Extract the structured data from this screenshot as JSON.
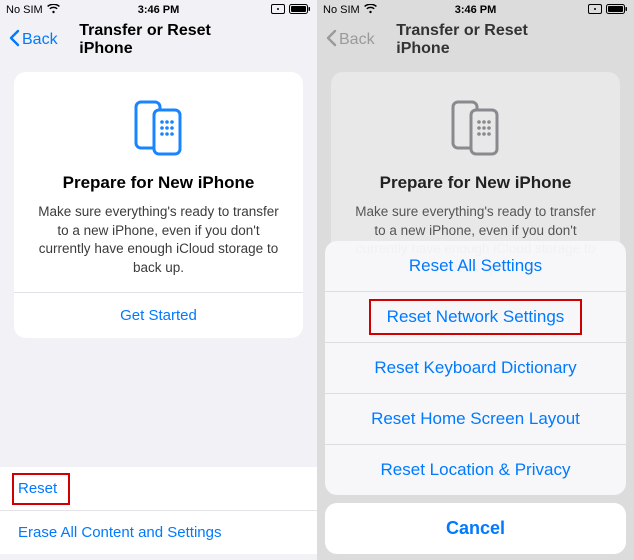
{
  "status": {
    "carrier": "No SIM",
    "time": "3:46 PM"
  },
  "nav": {
    "back_label": "Back",
    "title": "Transfer or Reset iPhone"
  },
  "card": {
    "title": "Prepare for New iPhone",
    "body": "Make sure everything's ready to transfer to a new iPhone, even if you don't currently have enough iCloud storage to back up.",
    "cta": "Get Started"
  },
  "left_list": {
    "reset": "Reset",
    "erase": "Erase All Content and Settings"
  },
  "sheet": {
    "items": [
      "Reset All Settings",
      "Reset Network Settings",
      "Reset Keyboard Dictionary",
      "Reset Home Screen Layout",
      "Reset Location & Privacy"
    ],
    "cancel": "Cancel"
  },
  "colors": {
    "accent": "#007aff",
    "highlight": "#d10000"
  }
}
